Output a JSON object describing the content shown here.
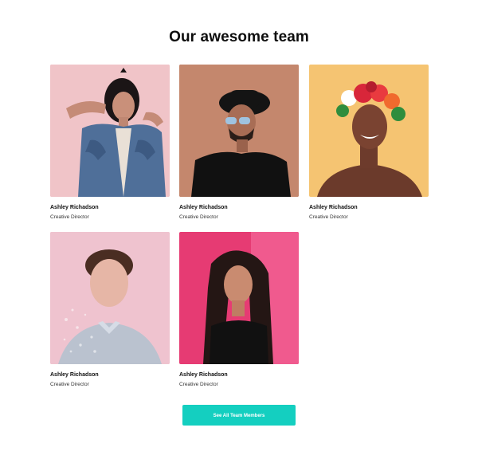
{
  "section": {
    "title": "Our awesome team"
  },
  "team": [
    {
      "name": "Ashley Richadson",
      "role": "Creative Director"
    },
    {
      "name": "Ashley Richadson",
      "role": "Creative Director"
    },
    {
      "name": "Ashley Richadson",
      "role": "Creative Director"
    },
    {
      "name": "Ashley Richadson",
      "role": "Creative Director"
    },
    {
      "name": "Ashley Richadson",
      "role": "Creative Director"
    }
  ],
  "cta": {
    "label": "See All Team Members",
    "color": "#14cfc0"
  }
}
